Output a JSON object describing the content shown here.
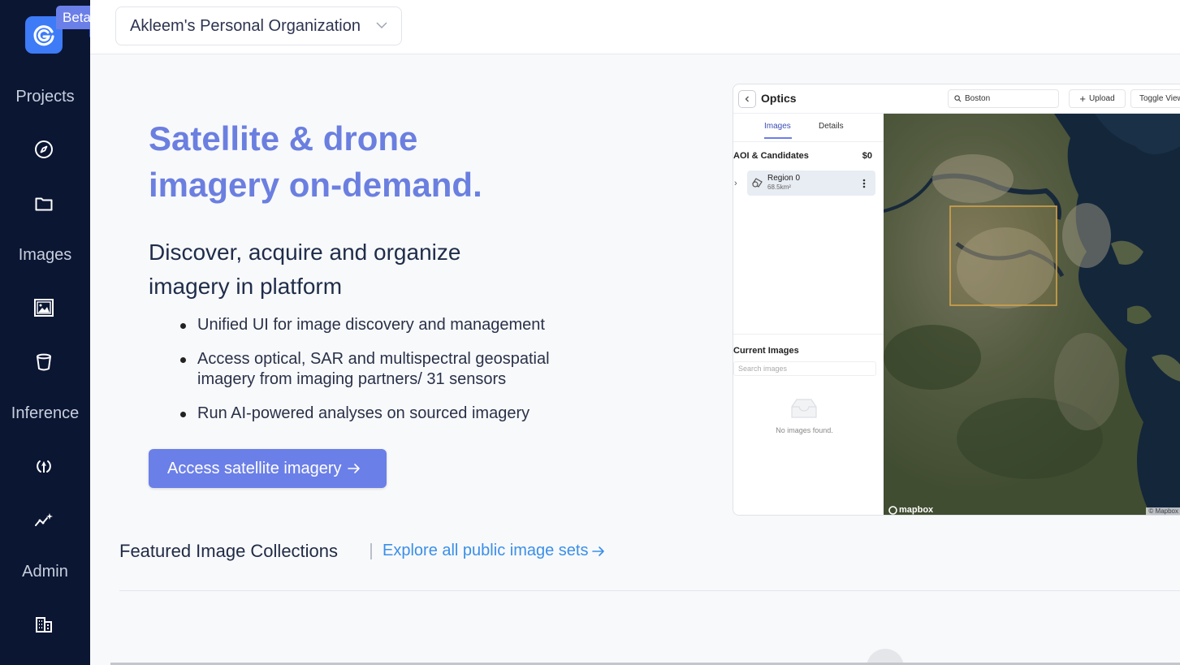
{
  "brand": {
    "badge": "Beta"
  },
  "org_selector": {
    "label": "Akleem's Personal Organization"
  },
  "sidebar": {
    "sections": [
      {
        "label": "Projects",
        "icons": [
          "compass-icon",
          "folder-icon"
        ]
      },
      {
        "label": "Images",
        "icons": [
          "image-icon",
          "bucket-icon"
        ]
      },
      {
        "label": "Inference",
        "icons": [
          "deploy-icon",
          "sparkle-chart-icon"
        ]
      },
      {
        "label": "Admin",
        "icons": [
          "building-icon"
        ]
      }
    ]
  },
  "hero": {
    "title_line1": "Satellite & drone",
    "title_line2": "imagery on-demand.",
    "subtitle_line1": "Discover, acquire and organize",
    "subtitle_line2": "imagery in platform",
    "bullets": [
      "Unified UI for image discovery and management",
      "Access optical, SAR and multispectral geospatial imagery from imaging partners/ 31 sensors",
      "Run AI-powered analyses on sourced imagery"
    ],
    "cta_label": "Access satellite imagery"
  },
  "preview": {
    "title": "Optics",
    "search_value": "Boston",
    "upload_label": "Upload",
    "toggle_label": "Toggle View",
    "tabs": [
      "Images",
      "Details"
    ],
    "aoi_heading": "AOI & Candidates",
    "aoi_cost": "$0",
    "region_name": "Region 0",
    "region_area": "68.5km²",
    "current_images_heading": "Current Images",
    "search_placeholder": "Search images",
    "empty_text": "No images found.",
    "map_logo": "mapbox",
    "map_attribution": "© Mapbox"
  },
  "featured": {
    "heading": "Featured Image Collections",
    "explore_label": "Explore all public image sets"
  },
  "colors": {
    "sidebar_bg": "#0b1633",
    "accent": "#6b7fe8",
    "hero_title": "#6b7fe0",
    "link": "#3a8fe8"
  }
}
